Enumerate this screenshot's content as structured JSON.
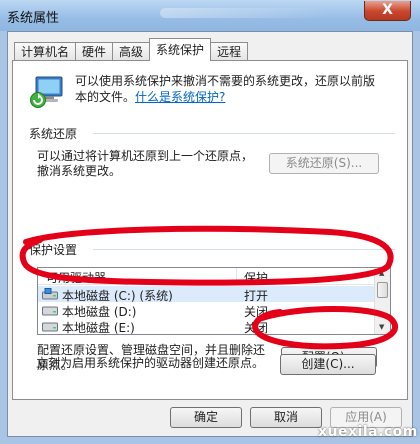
{
  "window": {
    "title": "系统属性",
    "close_glyph": "X"
  },
  "tabs": [
    {
      "label": "计算机名",
      "active": false
    },
    {
      "label": "硬件",
      "active": false
    },
    {
      "label": "高级",
      "active": false
    },
    {
      "label": "系统保护",
      "active": true
    },
    {
      "label": "远程",
      "active": false
    }
  ],
  "intro": {
    "line1": "可以使用系统保护来撤消不需要的系统更改，还原以前版",
    "line2_prefix": "本的文件。",
    "link": "什么是系统保护?"
  },
  "restore": {
    "title": "系统还原",
    "line1": "可以通过将计算机还原到上一个还原点，",
    "line2": "撤消系统更改。",
    "button": "系统还原(S)..."
  },
  "protection": {
    "title": "保护设置",
    "columns": {
      "drive": "可用驱动器",
      "protection": "保护"
    },
    "rows": [
      {
        "drive": "本地磁盘 (C:) (系统)",
        "protection": "打开",
        "selected": true
      },
      {
        "drive": "本地磁盘 (D:)",
        "protection": "关闭",
        "selected": false
      },
      {
        "drive": "本地磁盘 (E:)",
        "protection": "关闭",
        "selected": false
      }
    ],
    "configure_line1": "配置还原设置、管理磁盘空间，并且删除还",
    "configure_line2": "原点。",
    "configure_button": "配置(O)...",
    "create_text": "立刻为启用系统保护的驱动器创建还原点。",
    "create_button": "创建(C)..."
  },
  "footer": {
    "ok": "确定",
    "cancel": "取消",
    "apply": "应用(A)"
  },
  "watermark": "xuexila.com",
  "colors": {
    "annotation_red": "#e5001a",
    "link": "#0066cc",
    "selection": "#dcebfc"
  }
}
